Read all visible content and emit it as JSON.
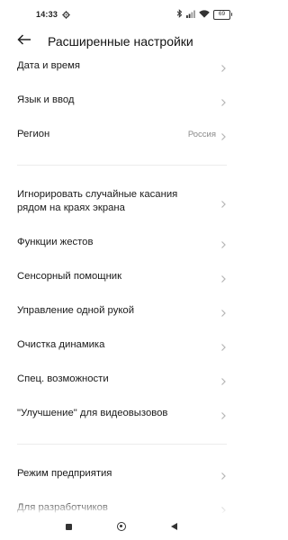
{
  "status_bar": {
    "time": "14:33",
    "battery": "69",
    "icons": [
      "gear-icon",
      "bluetooth-icon",
      "signal-icon",
      "wifi-icon",
      "battery-icon"
    ]
  },
  "header": {
    "title": "Расширенные настройки",
    "back_icon": "arrow-left-icon"
  },
  "items": [
    {
      "label": "Дата и время",
      "value": ""
    },
    {
      "label": "Язык и ввод",
      "value": ""
    },
    {
      "label": "Регион",
      "value": "Россия"
    },
    {
      "label": "Игнорировать случайные касания рядом на краях экрана",
      "value": ""
    },
    {
      "label": "Функции жестов",
      "value": ""
    },
    {
      "label": "Сенсорный помощник",
      "value": ""
    },
    {
      "label": "Управление одной рукой",
      "value": ""
    },
    {
      "label": "Очистка динамика",
      "value": ""
    },
    {
      "label": "Спец. возможности",
      "value": ""
    },
    {
      "label": "\"Улучшение\" для видеовызовов",
      "value": ""
    },
    {
      "label": "Режим предприятия",
      "value": ""
    },
    {
      "label": "Для разработчиков",
      "value": ""
    }
  ],
  "nav_bar": {
    "icons": [
      "recents-square-icon",
      "home-circle-icon",
      "back-triangle-icon"
    ]
  },
  "colors": {
    "text": "#1a1a1a",
    "secondary": "#8a8a8a",
    "chevron": "#b5b5b5",
    "divider": "#ececec"
  }
}
